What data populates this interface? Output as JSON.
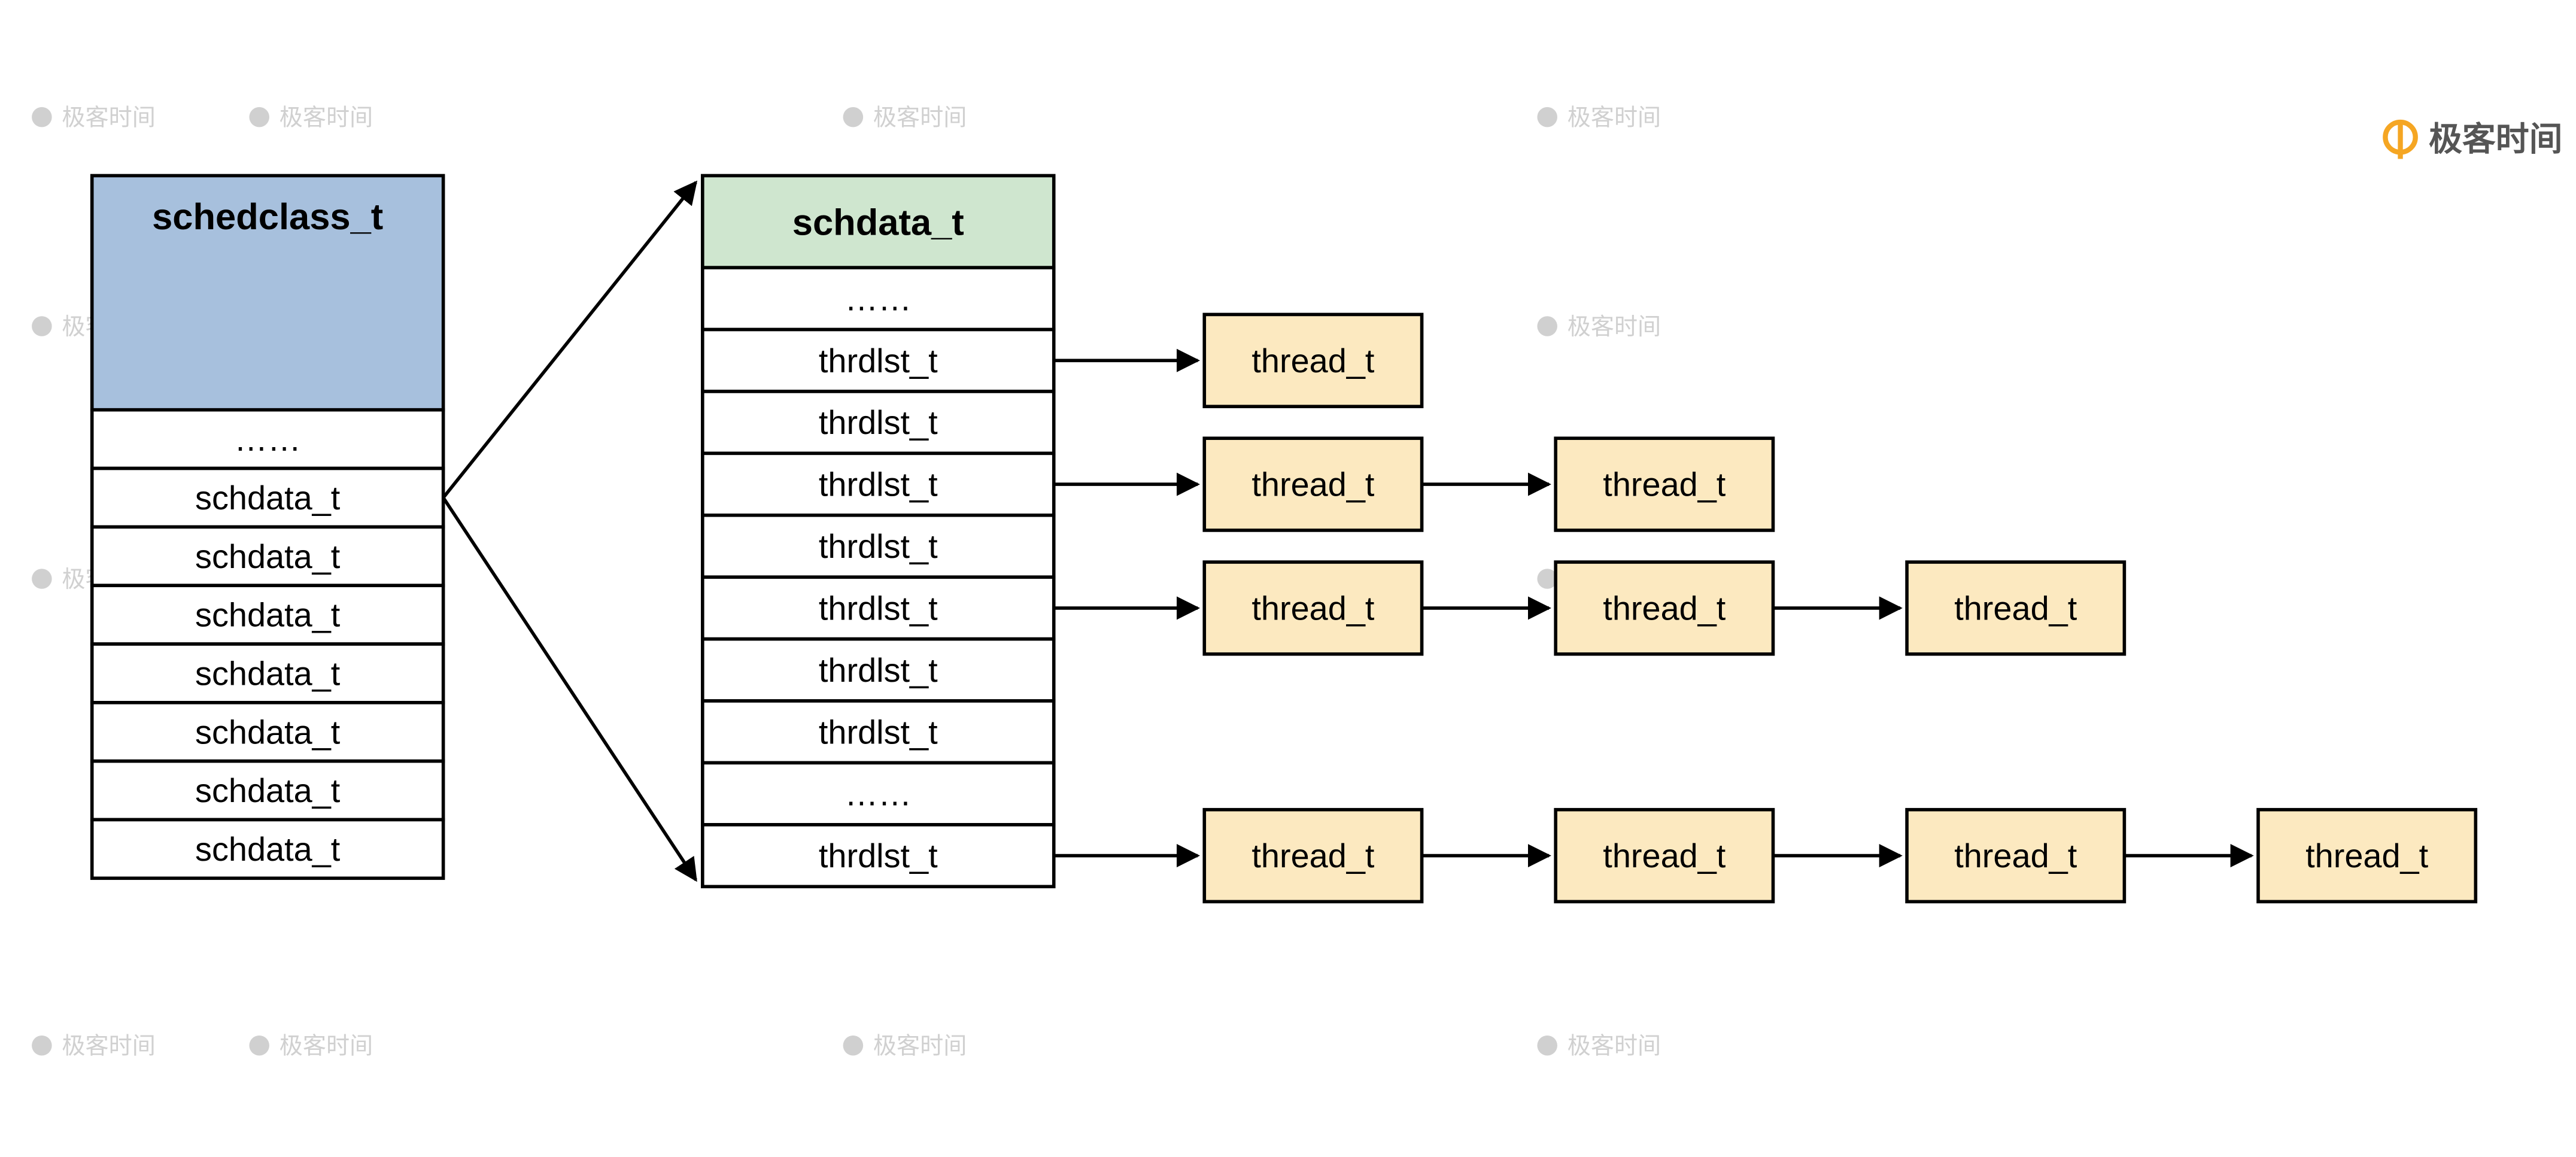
{
  "watermark": {
    "text": "极客时间",
    "logo_color": "#f5a623"
  },
  "schedclass": {
    "title": "schedclass_t",
    "header_fill": "#a7c0dd",
    "rows": [
      "……",
      "schdata_t",
      "schdata_t",
      "schdata_t",
      "schdata_t",
      "schdata_t",
      "schdata_t",
      "schdata_t"
    ]
  },
  "schdata": {
    "title": "schdata_t",
    "header_fill": "#cfe6cf",
    "rows": [
      "……",
      "thrdlst_t",
      "thrdlst_t",
      "thrdlst_t",
      "thrdlst_t",
      "thrdlst_t",
      "thrdlst_t",
      "thrdlst_t",
      "……",
      "thrdlst_t"
    ]
  },
  "thread_chains": {
    "label": "thread_t",
    "fill": "#fce9c0",
    "chains": [
      {
        "from_row": 1,
        "count": 1
      },
      {
        "from_row": 3,
        "count": 2
      },
      {
        "from_row": 5,
        "count": 3
      },
      {
        "from_row": 9,
        "count": 4
      }
    ]
  },
  "chart_data": {
    "type": "table",
    "title": "Scheduler data-structure diagram",
    "tables": [
      {
        "name": "schedclass_t",
        "header": "schedclass_t",
        "rows": [
          "……",
          "schdata_t",
          "schdata_t",
          "schdata_t",
          "schdata_t",
          "schdata_t",
          "schdata_t",
          "schdata_t"
        ]
      },
      {
        "name": "schdata_t",
        "header": "schdata_t",
        "rows": [
          "……",
          "thrdlst_t",
          "thrdlst_t",
          "thrdlst_t",
          "thrdlst_t",
          "thrdlst_t",
          "thrdlst_t",
          "thrdlst_t",
          "……",
          "thrdlst_t"
        ]
      }
    ],
    "linked_lists": [
      {
        "source": "schdata_t.thrdlst_t[1]",
        "nodes": [
          "thread_t"
        ]
      },
      {
        "source": "schdata_t.thrdlst_t[3]",
        "nodes": [
          "thread_t",
          "thread_t"
        ]
      },
      {
        "source": "schdata_t.thrdlst_t[5]",
        "nodes": [
          "thread_t",
          "thread_t",
          "thread_t"
        ]
      },
      {
        "source": "schdata_t.thrdlst_t[9]",
        "nodes": [
          "thread_t",
          "thread_t",
          "thread_t",
          "thread_t"
        ]
      }
    ],
    "fan_out": {
      "from": "schedclass_t.schdata_t[0]",
      "to": "schdata_t"
    }
  }
}
